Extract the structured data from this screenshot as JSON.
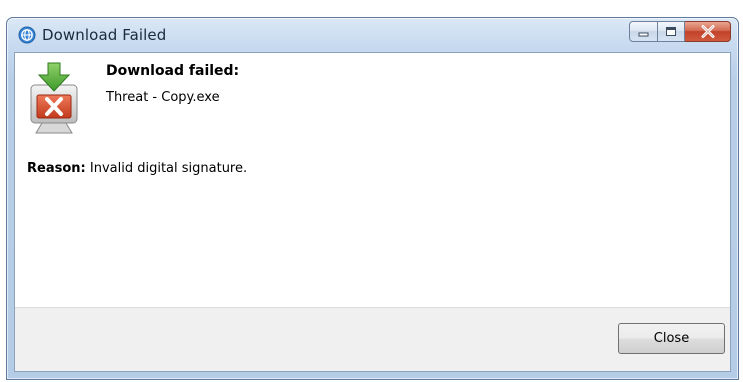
{
  "window": {
    "title": "Download Failed",
    "controls": {
      "minimize_icon": "minimize-icon",
      "maximize_icon": "maximize-icon",
      "close_icon": "close-x-icon"
    }
  },
  "message": {
    "icon": "download-failed-icon",
    "heading": "Download failed:",
    "filename": "Threat - Copy.exe",
    "reason_label": "Reason:",
    "reason_text": "Invalid digital signature."
  },
  "footer": {
    "close_label": "Close"
  },
  "colors": {
    "close_button_red": "#c2412a",
    "titlebar_blue": "#c6d9ef",
    "footer_gray": "#f0f0f0"
  }
}
